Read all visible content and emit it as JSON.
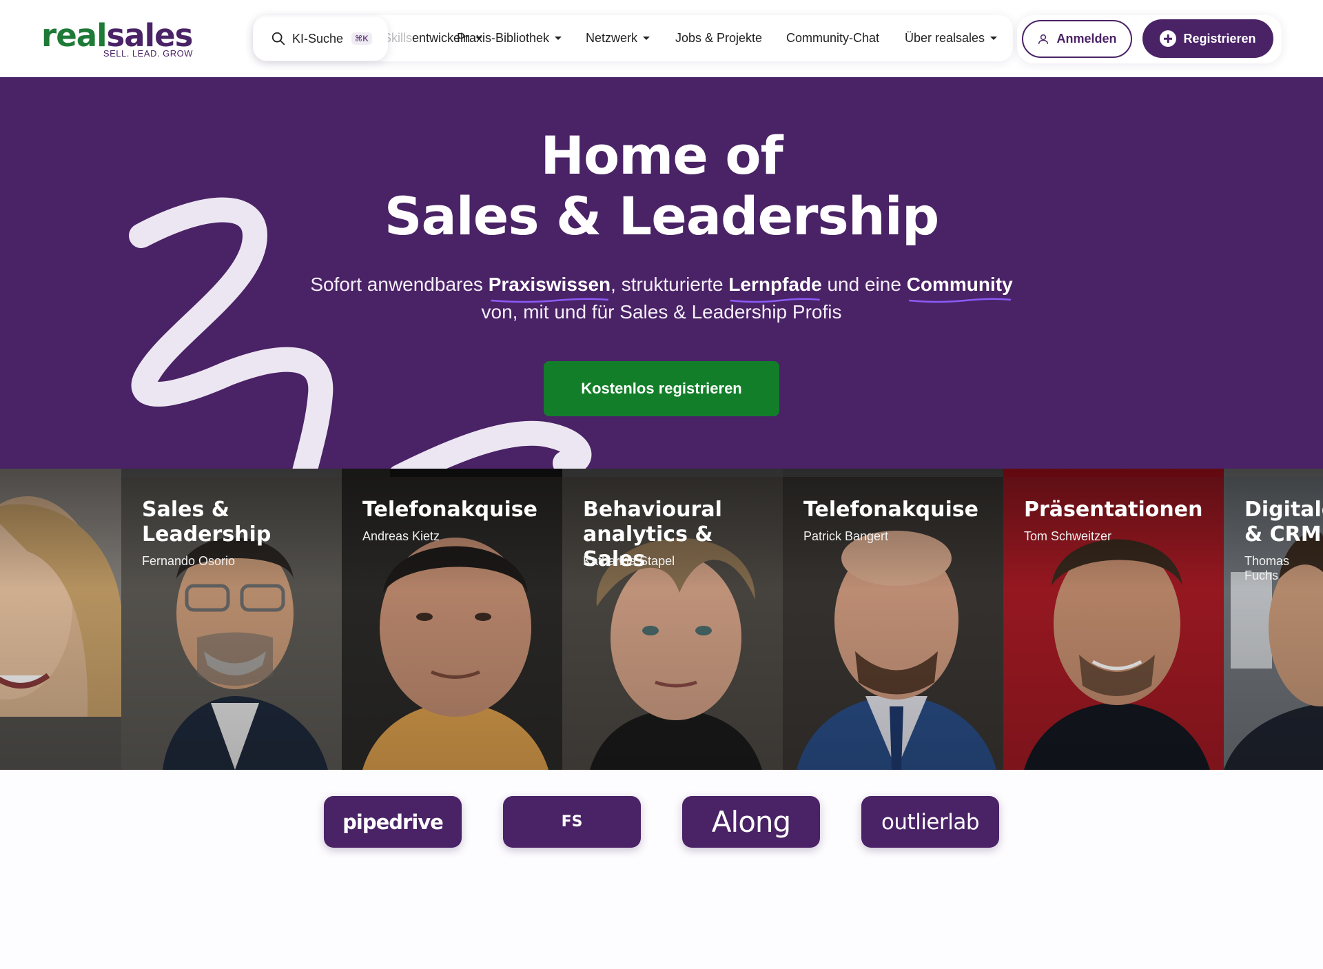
{
  "logo": {
    "part1": "real",
    "part2": "sales",
    "tagline": "SELL. LEAD. GROW"
  },
  "search": {
    "label": "KI-Suche",
    "shortcut": "⌘K"
  },
  "nav": {
    "items": [
      {
        "label": "entwickeln",
        "faded_prefix": "Skills"
      },
      {
        "label": "Praxis-Bibliothek"
      },
      {
        "label": "Netzwerk"
      },
      {
        "label": "Jobs & Projekte"
      },
      {
        "label": "Community-Chat"
      },
      {
        "label": "Über realsales"
      }
    ]
  },
  "auth": {
    "login_label": "Anmelden",
    "register_label": "Registrieren"
  },
  "hero": {
    "title_line1": "Home of",
    "title_line2": "Sales & Leadership",
    "sub_1": "Sofort anwendbares ",
    "sub_hl1": "Praxiswissen",
    "sub_2": ", strukturierte ",
    "sub_hl2": "Lernpfade",
    "sub_3": " und eine ",
    "sub_hl3": "Community",
    "sub_line2": "von, mit und für Sales & Leadership Profis",
    "cta_label": "Kostenlos registrieren",
    "colors": {
      "background": "#4a2266",
      "cta": "#137e2a",
      "underline": "#8b5cf6"
    }
  },
  "cards": [
    {
      "title": "",
      "author": ""
    },
    {
      "title": "Sales &\nLeadership",
      "author": "Fernando Osorio"
    },
    {
      "title": "Telefonakquise",
      "author": "Andreas Kietz"
    },
    {
      "title": "Behavioural\nanalytics & Sales",
      "author": "Katharina Stapel"
    },
    {
      "title": "Telefonakquise",
      "author": "Patrick Bangert"
    },
    {
      "title": "Präsentationen",
      "author": "Tom Schweitzer"
    },
    {
      "title": "Digitale\n& CRM",
      "author": "Thomas Fuchs"
    }
  ],
  "partners": [
    {
      "name": "pipedrive"
    },
    {
      "name": "FS"
    },
    {
      "name": "Along"
    },
    {
      "name": "outlierlab"
    }
  ]
}
